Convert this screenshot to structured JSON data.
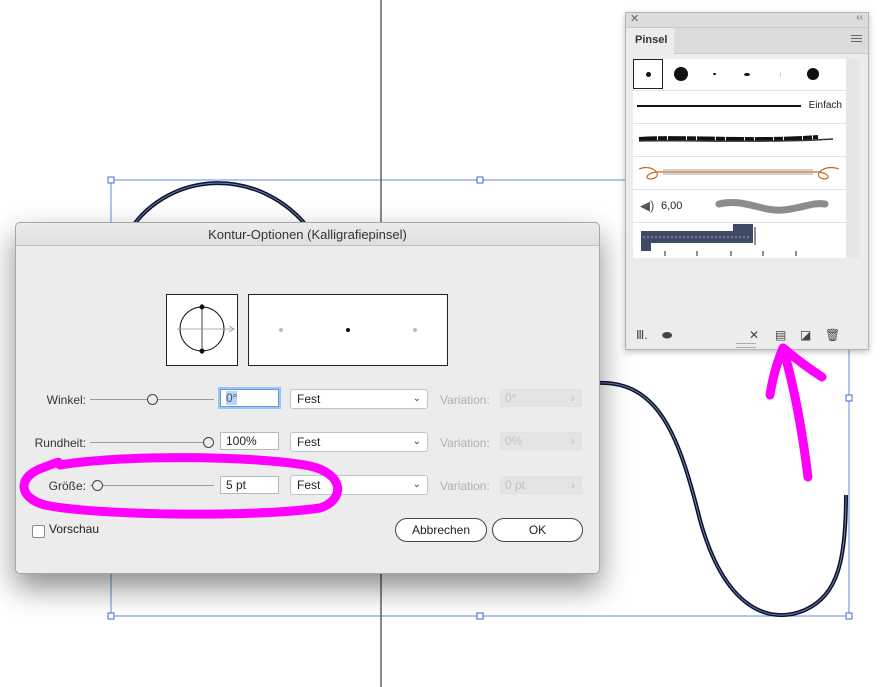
{
  "brushes_panel": {
    "close_icon": "close-icon",
    "collapse_icon": "double-chevron-icon",
    "tab_label": "Pinsel",
    "menu_icon": "hamburger-menu-icon",
    "row_basic_label": "Einfach",
    "row_bristle_size": "6,00",
    "footer_icons": [
      "brush-library-icon",
      "libraries-panel-icon",
      "remove-brush-stroke-icon",
      "stroke-options-icon",
      "new-brush-icon",
      "delete-brush-icon"
    ]
  },
  "dialog": {
    "title": "Kontur-Optionen (Kalligrafiepinsel)",
    "rows": [
      {
        "label": "Winkel:",
        "value": "0°",
        "method": "Fest",
        "variation_label": "Variation:",
        "variation_value": "0°"
      },
      {
        "label": "Rundheit:",
        "value": "100%",
        "method": "Fest",
        "variation_label": "Variation:",
        "variation_value": "0%"
      },
      {
        "label": "Größe:",
        "value": "5 pt",
        "method": "Fest",
        "variation_label": "Variation:",
        "variation_value": "0 pt"
      }
    ],
    "preview_checkbox_label": "Vorschau",
    "cancel_label": "Abbrechen",
    "ok_label": "OK"
  },
  "colors": {
    "annotation": "#ff00ff",
    "selection": "#3a6fd8",
    "path_stroke": "#0b1230"
  }
}
